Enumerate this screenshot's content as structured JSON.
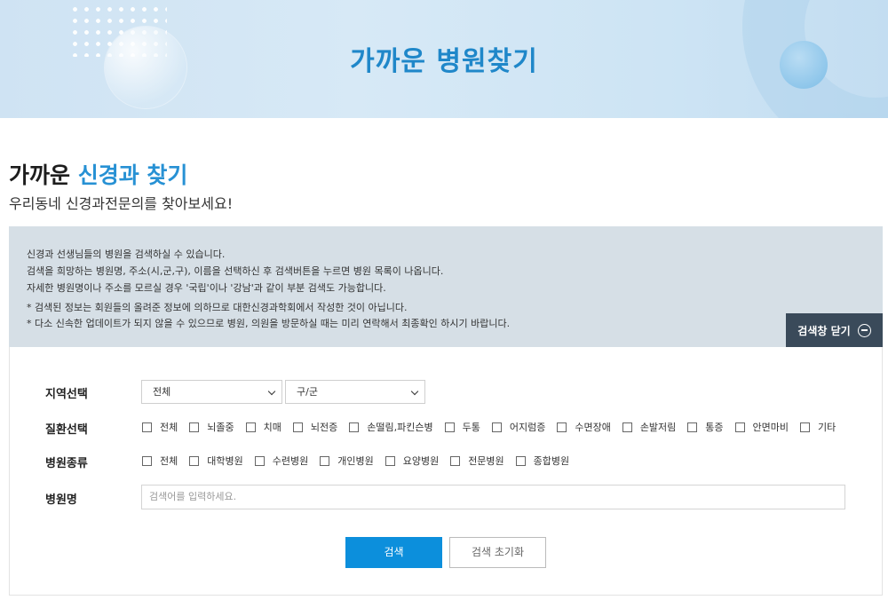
{
  "banner": {
    "title": "가까운 병원찾기"
  },
  "heading": {
    "prefix": "가까운 ",
    "highlight": "신경과 찾기",
    "subtitle": "우리동네 신경과전문의를 찾아보세요!"
  },
  "info": {
    "lines": [
      "신경과 선생님들의 병원을 검색하실 수 있습니다.",
      "검색을 희망하는 병원명, 주소(시,군,구), 이름을 선택하신 후 검색버튼을 누르면 병원 목록이 나옵니다.",
      "자세한 병원명이나 주소를 모르실 경우 '국립'이나 '강남'과 같이 부분 검색도 가능합니다.",
      "*  검색된 정보는 회원들의 올려준 정보에 의하므로 대한신경과학회에서 작성한 것이 아닙니다.",
      "*  다소 신속한 업데이트가 되지 않을 수 있으므로 병원, 의원을 방문하실 때는 미리 연락해서 최종확인 하시기 바랍니다."
    ],
    "close_label": "검색창 닫기"
  },
  "form": {
    "region": {
      "label": "지역선택",
      "city_value": "전체",
      "district_value": "구/군"
    },
    "disease": {
      "label": "질환선택",
      "options": [
        "전체",
        "뇌졸중",
        "치매",
        "뇌전증",
        "손떨림,파킨슨병",
        "두통",
        "어지럼증",
        "수면장애",
        "손발저림",
        "통증",
        "안면마비",
        "기타"
      ]
    },
    "hospital_type": {
      "label": "병원종류",
      "options": [
        "전체",
        "대학병원",
        "수련병원",
        "개인병원",
        "요양병원",
        "전문병원",
        "종합병원"
      ]
    },
    "hospital_name": {
      "label": "병원명",
      "placeholder": "검색어를 입력하세요."
    },
    "search_label": "검색",
    "reset_label": "검색 초기화"
  },
  "icons": {
    "close": "minus-circle-icon",
    "dropdown": "chevron-down-icon",
    "checkbox": "checkbox-icon"
  },
  "colors": {
    "accent": "#0c8fdc",
    "title_blue": "#1f87c9",
    "dark_button": "#3a4a5a"
  }
}
